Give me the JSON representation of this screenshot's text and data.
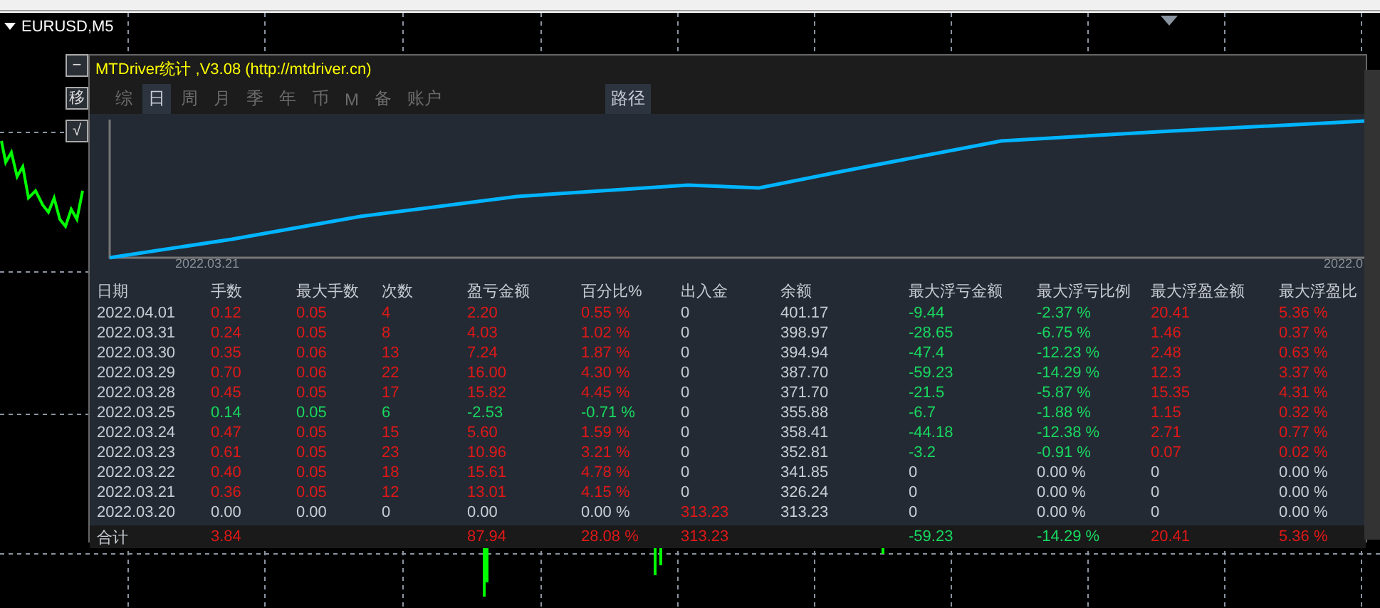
{
  "chart_window": {
    "symbol": "EURUSD,M5"
  },
  "side_buttons": [
    {
      "label": "−"
    },
    {
      "label": "移"
    },
    {
      "label": "√"
    }
  ],
  "panel": {
    "title": "MTDriver统计 ,V3.08 (http://mtdriver.cn)",
    "tabs": [
      {
        "label": "综",
        "selected": false
      },
      {
        "label": "日",
        "selected": true
      },
      {
        "label": "周",
        "selected": false
      },
      {
        "label": "月",
        "selected": false
      },
      {
        "label": "季",
        "selected": false
      },
      {
        "label": "年",
        "selected": false
      },
      {
        "label": "币",
        "selected": false
      },
      {
        "label": "M",
        "selected": false
      },
      {
        "label": "备",
        "selected": false
      },
      {
        "label": "账户",
        "selected": false
      }
    ],
    "path_button": {
      "label": "路径"
    },
    "equity_chart": {
      "x_labels": [
        "2022.03.21",
        "2022.0"
      ]
    },
    "table": {
      "columns": [
        "日期",
        "手数",
        "最大手数",
        "次数",
        "盈亏金额",
        "百分比%",
        "出入金",
        "余额",
        "最大浮亏金额",
        "最大浮亏比例",
        "最大浮盈金额",
        "最大浮盈比"
      ],
      "rows": [
        {
          "cells": [
            {
              "text": "2022.04.01",
              "kind": "flat"
            },
            {
              "text": "0.12",
              "kind": "up"
            },
            {
              "text": "0.05",
              "kind": "up"
            },
            {
              "text": "4",
              "kind": "up"
            },
            {
              "text": "2.20",
              "kind": "up"
            },
            {
              "text": "0.55 %",
              "kind": "up"
            },
            {
              "text": "0",
              "kind": "flat"
            },
            {
              "text": "401.17",
              "kind": "flat"
            },
            {
              "text": "-9.44",
              "kind": "down"
            },
            {
              "text": "-2.37 %",
              "kind": "down"
            },
            {
              "text": "20.41",
              "kind": "up"
            },
            {
              "text": "5.36 %",
              "kind": "up"
            }
          ]
        },
        {
          "cells": [
            {
              "text": "2022.03.31",
              "kind": "flat"
            },
            {
              "text": "0.24",
              "kind": "up"
            },
            {
              "text": "0.05",
              "kind": "up"
            },
            {
              "text": "8",
              "kind": "up"
            },
            {
              "text": "4.03",
              "kind": "up"
            },
            {
              "text": "1.02 %",
              "kind": "up"
            },
            {
              "text": "0",
              "kind": "flat"
            },
            {
              "text": "398.97",
              "kind": "flat"
            },
            {
              "text": "-28.65",
              "kind": "down"
            },
            {
              "text": "-6.75 %",
              "kind": "down"
            },
            {
              "text": "1.46",
              "kind": "up"
            },
            {
              "text": "0.37 %",
              "kind": "up"
            }
          ]
        },
        {
          "cells": [
            {
              "text": "2022.03.30",
              "kind": "flat"
            },
            {
              "text": "0.35",
              "kind": "up"
            },
            {
              "text": "0.06",
              "kind": "up"
            },
            {
              "text": "13",
              "kind": "up"
            },
            {
              "text": "7.24",
              "kind": "up"
            },
            {
              "text": "1.87 %",
              "kind": "up"
            },
            {
              "text": "0",
              "kind": "flat"
            },
            {
              "text": "394.94",
              "kind": "flat"
            },
            {
              "text": "-47.4",
              "kind": "down"
            },
            {
              "text": "-12.23 %",
              "kind": "down"
            },
            {
              "text": "2.48",
              "kind": "up"
            },
            {
              "text": "0.63 %",
              "kind": "up"
            }
          ]
        },
        {
          "cells": [
            {
              "text": "2022.03.29",
              "kind": "flat"
            },
            {
              "text": "0.70",
              "kind": "up"
            },
            {
              "text": "0.06",
              "kind": "up"
            },
            {
              "text": "22",
              "kind": "up"
            },
            {
              "text": "16.00",
              "kind": "up"
            },
            {
              "text": "4.30 %",
              "kind": "up"
            },
            {
              "text": "0",
              "kind": "flat"
            },
            {
              "text": "387.70",
              "kind": "flat"
            },
            {
              "text": "-59.23",
              "kind": "down"
            },
            {
              "text": "-14.29 %",
              "kind": "down"
            },
            {
              "text": "12.3",
              "kind": "up"
            },
            {
              "text": "3.37 %",
              "kind": "up"
            }
          ]
        },
        {
          "cells": [
            {
              "text": "2022.03.28",
              "kind": "flat"
            },
            {
              "text": "0.45",
              "kind": "up"
            },
            {
              "text": "0.05",
              "kind": "up"
            },
            {
              "text": "17",
              "kind": "up"
            },
            {
              "text": "15.82",
              "kind": "up"
            },
            {
              "text": "4.45 %",
              "kind": "up"
            },
            {
              "text": "0",
              "kind": "flat"
            },
            {
              "text": "371.70",
              "kind": "flat"
            },
            {
              "text": "-21.5",
              "kind": "down"
            },
            {
              "text": "-5.87 %",
              "kind": "down"
            },
            {
              "text": "15.35",
              "kind": "up"
            },
            {
              "text": "4.31 %",
              "kind": "up"
            }
          ]
        },
        {
          "cells": [
            {
              "text": "2022.03.25",
              "kind": "flat"
            },
            {
              "text": "0.14",
              "kind": "down"
            },
            {
              "text": "0.05",
              "kind": "down"
            },
            {
              "text": "6",
              "kind": "down"
            },
            {
              "text": "-2.53",
              "kind": "down"
            },
            {
              "text": "-0.71 %",
              "kind": "down"
            },
            {
              "text": "0",
              "kind": "flat"
            },
            {
              "text": "355.88",
              "kind": "flat"
            },
            {
              "text": "-6.7",
              "kind": "down"
            },
            {
              "text": "-1.88 %",
              "kind": "down"
            },
            {
              "text": "1.15",
              "kind": "up"
            },
            {
              "text": "0.32 %",
              "kind": "up"
            }
          ]
        },
        {
          "cells": [
            {
              "text": "2022.03.24",
              "kind": "flat"
            },
            {
              "text": "0.47",
              "kind": "up"
            },
            {
              "text": "0.05",
              "kind": "up"
            },
            {
              "text": "15",
              "kind": "up"
            },
            {
              "text": "5.60",
              "kind": "up"
            },
            {
              "text": "1.59 %",
              "kind": "up"
            },
            {
              "text": "0",
              "kind": "flat"
            },
            {
              "text": "358.41",
              "kind": "flat"
            },
            {
              "text": "-44.18",
              "kind": "down"
            },
            {
              "text": "-12.38 %",
              "kind": "down"
            },
            {
              "text": "2.71",
              "kind": "up"
            },
            {
              "text": "0.77 %",
              "kind": "up"
            }
          ]
        },
        {
          "cells": [
            {
              "text": "2022.03.23",
              "kind": "flat"
            },
            {
              "text": "0.61",
              "kind": "up"
            },
            {
              "text": "0.05",
              "kind": "up"
            },
            {
              "text": "23",
              "kind": "up"
            },
            {
              "text": "10.96",
              "kind": "up"
            },
            {
              "text": "3.21 %",
              "kind": "up"
            },
            {
              "text": "0",
              "kind": "flat"
            },
            {
              "text": "352.81",
              "kind": "flat"
            },
            {
              "text": "-3.2",
              "kind": "down"
            },
            {
              "text": "-0.91 %",
              "kind": "down"
            },
            {
              "text": "0.07",
              "kind": "up"
            },
            {
              "text": "0.02 %",
              "kind": "up"
            }
          ]
        },
        {
          "cells": [
            {
              "text": "2022.03.22",
              "kind": "flat"
            },
            {
              "text": "0.40",
              "kind": "up"
            },
            {
              "text": "0.05",
              "kind": "up"
            },
            {
              "text": "18",
              "kind": "up"
            },
            {
              "text": "15.61",
              "kind": "up"
            },
            {
              "text": "4.78 %",
              "kind": "up"
            },
            {
              "text": "0",
              "kind": "flat"
            },
            {
              "text": "341.85",
              "kind": "flat"
            },
            {
              "text": "0",
              "kind": "flat"
            },
            {
              "text": "0.00 %",
              "kind": "flat"
            },
            {
              "text": "0",
              "kind": "flat"
            },
            {
              "text": "0.00 %",
              "kind": "flat"
            }
          ]
        },
        {
          "cells": [
            {
              "text": "2022.03.21",
              "kind": "flat"
            },
            {
              "text": "0.36",
              "kind": "up"
            },
            {
              "text": "0.05",
              "kind": "up"
            },
            {
              "text": "12",
              "kind": "up"
            },
            {
              "text": "13.01",
              "kind": "up"
            },
            {
              "text": "4.15 %",
              "kind": "up"
            },
            {
              "text": "0",
              "kind": "flat"
            },
            {
              "text": "326.24",
              "kind": "flat"
            },
            {
              "text": "0",
              "kind": "flat"
            },
            {
              "text": "0.00 %",
              "kind": "flat"
            },
            {
              "text": "0",
              "kind": "flat"
            },
            {
              "text": "0.00 %",
              "kind": "flat"
            }
          ]
        },
        {
          "cells": [
            {
              "text": "2022.03.20",
              "kind": "flat"
            },
            {
              "text": "0.00",
              "kind": "flat"
            },
            {
              "text": "0.00",
              "kind": "flat"
            },
            {
              "text": "0",
              "kind": "flat"
            },
            {
              "text": "0.00",
              "kind": "flat"
            },
            {
              "text": "0.00 %",
              "kind": "flat"
            },
            {
              "text": "313.23",
              "kind": "up"
            },
            {
              "text": "313.23",
              "kind": "flat"
            },
            {
              "text": "0",
              "kind": "flat"
            },
            {
              "text": "0.00 %",
              "kind": "flat"
            },
            {
              "text": "0",
              "kind": "flat"
            },
            {
              "text": "0.00 %",
              "kind": "flat"
            }
          ]
        }
      ],
      "total": {
        "cells": [
          {
            "text": "合计",
            "kind": "flat"
          },
          {
            "text": "3.84",
            "kind": "up"
          },
          {
            "kind": "blank"
          },
          {
            "kind": "blank"
          },
          {
            "text": "87.94",
            "kind": "up"
          },
          {
            "text": "28.08 %",
            "kind": "up"
          },
          {
            "text": "313.23",
            "kind": "up"
          },
          {
            "kind": "blank"
          },
          {
            "text": "-59.23",
            "kind": "down"
          },
          {
            "text": "-14.29 %",
            "kind": "down"
          },
          {
            "text": "20.41",
            "kind": "up"
          },
          {
            "text": "5.36 %",
            "kind": "up"
          }
        ]
      }
    }
  }
}
